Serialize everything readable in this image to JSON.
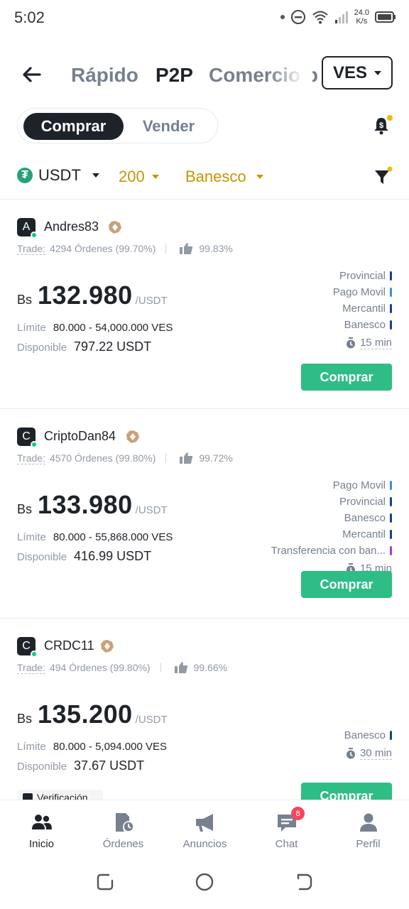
{
  "status_bar": {
    "time": "5:02",
    "speed_value": "24.0",
    "speed_unit": "K/s"
  },
  "header": {
    "tabs": [
      {
        "label": "Rápido",
        "active": false
      },
      {
        "label": "P2P",
        "active": true
      },
      {
        "label": "Comercio p",
        "active": false
      }
    ],
    "currency": "VES"
  },
  "toggle": {
    "buy_label": "Comprar",
    "sell_label": "Vender"
  },
  "filters": {
    "coin": "USDT",
    "amount": "200",
    "payment": "Banesco"
  },
  "ads": [
    {
      "avatar_letter": "A",
      "name": "Andres83",
      "trade_label": "Trade:",
      "orders": "4294 Órdenes (99.70%)",
      "rating": "99.83%",
      "currency_symbol": "Bs",
      "price": "132.980",
      "price_unit": "/USDT",
      "limit_label": "Límite",
      "limit": "80.000 - 54,000.000 VES",
      "available_label": "Disponible",
      "available": "797.22 USDT",
      "payments": [
        {
          "name": "Provincial",
          "color": "#1a3e8a"
        },
        {
          "name": "Pago Movil",
          "color": "#3d8ed8"
        },
        {
          "name": "Mercantil",
          "color": "#1a3e8a"
        },
        {
          "name": "Banesco",
          "color": "#1a3e8a"
        }
      ],
      "time": "15 min",
      "button": "Comprar"
    },
    {
      "avatar_letter": "C",
      "name": "CriptoDan84",
      "trade_label": "Trade:",
      "orders": "4570 Órdenes (99.80%)",
      "rating": "99.72%",
      "currency_symbol": "Bs",
      "price": "133.980",
      "price_unit": "/USDT",
      "limit_label": "Límite",
      "limit": "80.000 - 55,868.000 VES",
      "available_label": "Disponible",
      "available": "416.99 USDT",
      "payments": [
        {
          "name": "Pago Movil",
          "color": "#3d8ed8"
        },
        {
          "name": "Provincial",
          "color": "#1a3e8a"
        },
        {
          "name": "Banesco",
          "color": "#1a3e8a"
        },
        {
          "name": "Mercantil",
          "color": "#1a3e8a"
        },
        {
          "name": "Transferencia con ban...",
          "color": "#a03ed0"
        }
      ],
      "time": "15 min",
      "button": "Comprar"
    },
    {
      "avatar_letter": "C",
      "name": "CRDC11",
      "trade_label": "Trade:",
      "orders": "494 Órdenes (99.80%)",
      "rating": "99.66%",
      "currency_symbol": "Bs",
      "price": "135.200",
      "price_unit": "/USDT",
      "limit_label": "Límite",
      "limit": "80.000 - 5,094.000 VES",
      "available_label": "Disponible",
      "available": "37.67 USDT",
      "payments": [
        {
          "name": "Banesco",
          "color": "#1a3e8a"
        }
      ],
      "time": "30 min",
      "button": "Comprar",
      "verification": "Verificación"
    }
  ],
  "bottom_nav": [
    {
      "label": "Inicio",
      "icon": "home-users-icon",
      "active": true
    },
    {
      "label": "Órdenes",
      "icon": "orders-icon",
      "active": false
    },
    {
      "label": "Anuncios",
      "icon": "megaphone-icon",
      "active": false
    },
    {
      "label": "Chat",
      "icon": "chat-icon",
      "active": false,
      "badge": "8"
    },
    {
      "label": "Perfil",
      "icon": "profile-icon",
      "active": false
    }
  ],
  "colors": {
    "accent": "#2ebd85",
    "gold": "#c99400",
    "dark": "#1e2329",
    "muted": "#76808f"
  }
}
